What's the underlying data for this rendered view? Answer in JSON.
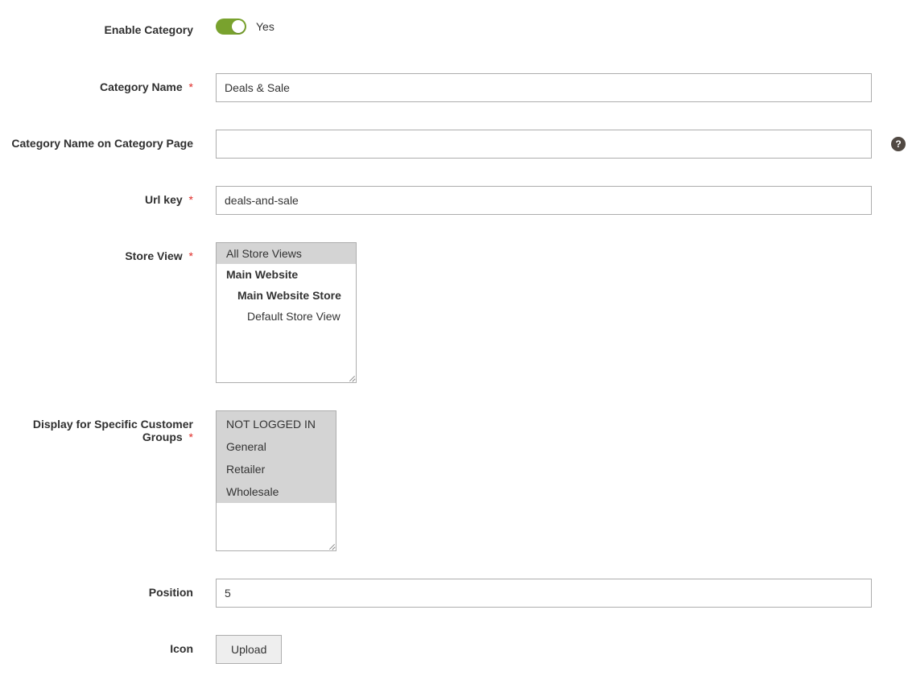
{
  "fields": {
    "enable_category": {
      "label": "Enable Category",
      "value": "Yes"
    },
    "category_name": {
      "label": "Category Name",
      "required": true,
      "value": "Deals & Sale"
    },
    "category_name_on_page": {
      "label": "Category Name on Category Page",
      "required": false,
      "value": ""
    },
    "url_key": {
      "label": "Url key",
      "required": true,
      "value": "deals-and-sale"
    },
    "store_view": {
      "label": "Store View",
      "required": true,
      "options": {
        "all": "All Store Views",
        "website": "Main Website",
        "store": "Main Website Store",
        "view": "Default Store View"
      }
    },
    "customer_groups": {
      "label": "Display for Specific Customer Groups",
      "required": true,
      "options": {
        "not_logged_in": "NOT LOGGED IN",
        "general": "General",
        "retailer": "Retailer",
        "wholesale": "Wholesale"
      }
    },
    "position": {
      "label": "Position",
      "value": "5"
    },
    "icon": {
      "label": "Icon",
      "button": "Upload"
    }
  },
  "required_marker": "*",
  "help_icon_text": "?"
}
